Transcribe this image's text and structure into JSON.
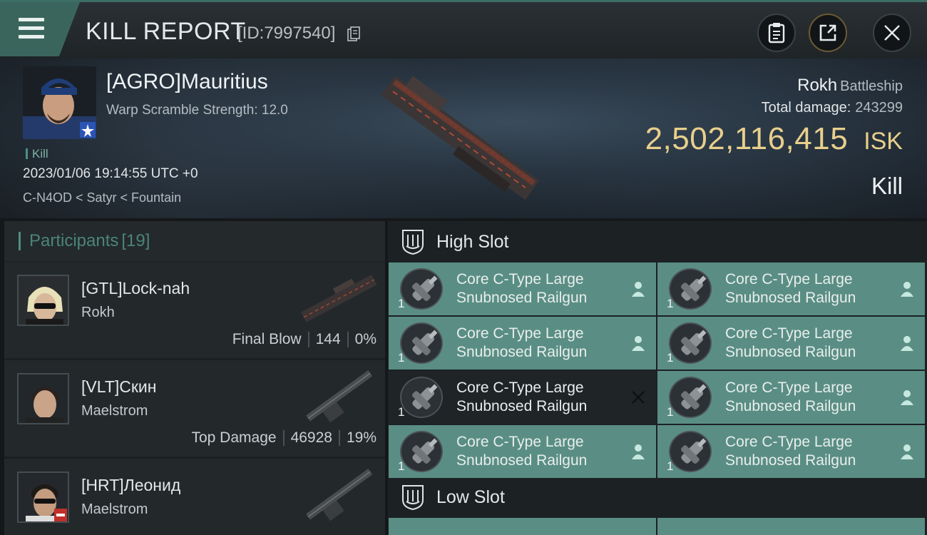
{
  "header": {
    "title": "KILL REPORT",
    "report_id": "[ID:7997540]"
  },
  "victim": {
    "name": "[AGRO]Mauritius",
    "warp_scramble": "Warp Scramble Strength: 12.0",
    "tag": "Kill",
    "timestamp": "2023/01/06 19:14:55 UTC +0",
    "location": "C-N4OD < Satyr < Fountain",
    "ship": "Rokh",
    "ship_class": "Battleship",
    "total_damage_label": "Total damage:",
    "total_damage": "243299",
    "isk_value": "2,502,116,415",
    "isk_unit": "ISK",
    "result": "Kill"
  },
  "participants": {
    "label": "Participants",
    "count": "[19]",
    "rows": [
      {
        "name": "[GTL]Lock-nah",
        "ship": "Rokh",
        "stat_label": "Final Blow",
        "damage": "144",
        "percent": "0%"
      },
      {
        "name": "[VLT]Скин",
        "ship": "Maelstrom",
        "stat_label": "Top Damage",
        "damage": "46928",
        "percent": "19%"
      },
      {
        "name": "[HRT]Леонид",
        "ship": "Maelstrom"
      }
    ]
  },
  "slots": {
    "high_label": "High Slot",
    "low_label": "Low Slot",
    "high": [
      {
        "qty": "1",
        "name_line1": "Core C-Type Large",
        "name_line2": "Snubnosed Railgun",
        "status": "dropped"
      },
      {
        "qty": "1",
        "name_line1": "Core C-Type Large",
        "name_line2": "Snubnosed Railgun",
        "status": "dropped"
      },
      {
        "qty": "1",
        "name_line1": "Core C-Type Large",
        "name_line2": "Snubnosed Railgun",
        "status": "dropped"
      },
      {
        "qty": "1",
        "name_line1": "Core C-Type Large",
        "name_line2": "Snubnosed Railgun",
        "status": "dropped"
      },
      {
        "qty": "1",
        "name_line1": "Core C-Type Large",
        "name_line2": "Snubnosed Railgun",
        "status": "destroyed"
      },
      {
        "qty": "1",
        "name_line1": "Core C-Type Large",
        "name_line2": "Snubnosed Railgun",
        "status": "dropped"
      },
      {
        "qty": "1",
        "name_line1": "Core C-Type Large",
        "name_line2": "Snubnosed Railgun",
        "status": "dropped"
      },
      {
        "qty": "1",
        "name_line1": "Core C-Type Large",
        "name_line2": "Snubnosed Railgun",
        "status": "dropped"
      }
    ]
  },
  "colors": {
    "accent": "#5a8e84",
    "isk": "#e8cf8c",
    "kill_tag": "#7fb2a4"
  },
  "icons": [
    "menu-icon",
    "copy-icon",
    "clipboard-icon",
    "share-icon",
    "close-icon",
    "shield-icon",
    "person-icon",
    "x-icon",
    "railgun-icon"
  ]
}
